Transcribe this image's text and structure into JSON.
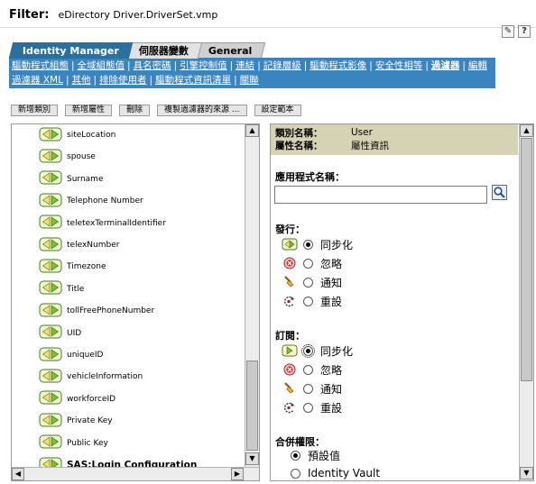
{
  "header": {
    "label": "Filter:",
    "value": "eDirectory Driver.DriverSet.vmp"
  },
  "top_icons": [
    {
      "name": "edit-filter-icon",
      "glyph": "✎"
    },
    {
      "name": "help-icon",
      "glyph": "?"
    }
  ],
  "tabs": [
    {
      "label": "Identity Manager",
      "active": true
    },
    {
      "label": "伺服器變數",
      "active": false
    },
    {
      "label": "General",
      "active": false
    }
  ],
  "nav": {
    "links": [
      "驅動程式組態",
      "全域組態值",
      "具名密碼",
      "引擎控制值",
      "連結",
      "記錄層級",
      "驅動程式影像",
      "安全性相等",
      "過濾器",
      "編輯過濾器 XML",
      "其他",
      "排除使用者",
      "驅動程式資訊清單",
      "關聯"
    ],
    "bold_link": "過濾器"
  },
  "toolbar": {
    "buttons": [
      "新增類別",
      "新增屬性",
      "刪除",
      "複製過濾器的來源 ...",
      "設定範本"
    ]
  },
  "attribute_list": {
    "items": [
      "siteLocation",
      "spouse",
      "Surname",
      "Telephone Number",
      "teletexTerminalIdentifier",
      "telexNumber",
      "Timezone",
      "Title",
      "tollFreePhoneNumber",
      "UID",
      "uniqueID",
      "vehicleInformation",
      "workforceID",
      "Private Key",
      "Public Key",
      "SAS:Login Configuration"
    ],
    "selected": "SAS:Login Configuration"
  },
  "details": {
    "class_label": "類別名稱：",
    "class_value": "User",
    "attr_label": "屬性名稱：",
    "attr_value": "屬性資訊",
    "app_name_label": "應用程式名稱：",
    "app_name_value": "",
    "publisher": {
      "label": "發行：",
      "options": [
        "同步化",
        "忽略",
        "通知",
        "重設"
      ],
      "selected": "同步化"
    },
    "subscriber": {
      "label": "訂閱：",
      "options": [
        "同步化",
        "忽略",
        "通知",
        "重設"
      ],
      "selected": "同步化"
    },
    "merge": {
      "label": "合併權限：",
      "options": [
        "預設值",
        "Identity Vault"
      ],
      "selected": "預設值"
    }
  },
  "colors": {
    "nav_bg": "#3a84c0",
    "active_tab": "#2b6f9f",
    "info_bg": "#d6d2b4"
  }
}
